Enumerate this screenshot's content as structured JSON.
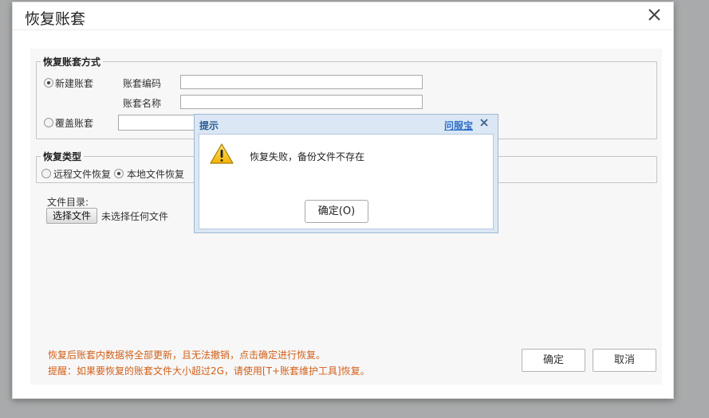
{
  "dialog": {
    "title": "恢复账套",
    "mode_group": {
      "legend": "恢复账套方式",
      "new_option": "新建账套",
      "code_label": "账套编码",
      "name_label": "账套名称",
      "overwrite_option": "覆盖账套",
      "code_value": "",
      "name_value": "",
      "overwrite_value": ""
    },
    "type_group": {
      "legend": "恢复类型",
      "remote_option": "远程文件恢复",
      "local_option": "本地文件恢复"
    },
    "file": {
      "dir_label": "文件目录:",
      "choose_button": "选择文件",
      "status": "未选择任何文件"
    },
    "notes": {
      "line1": "恢复后账套内数据将全部更新，且无法撤销，点击确定进行恢复。",
      "line2": "提醒：如果要恢复的账套文件大小超过2G，请使用[T+账套维护工具]恢复。"
    },
    "buttons": {
      "ok": "确定",
      "cancel": "取消"
    }
  },
  "alert": {
    "title": "提示",
    "help_link": "问服宝",
    "message": "恢复失败，备份文件不存在",
    "ok_button": "确定(O)",
    "icon": "warning-icon"
  },
  "colors": {
    "warning_text": "#d2601a",
    "alert_frame": "#dbe7f4",
    "alert_title": "#2a5a94",
    "help_link": "#2f6fc7"
  }
}
